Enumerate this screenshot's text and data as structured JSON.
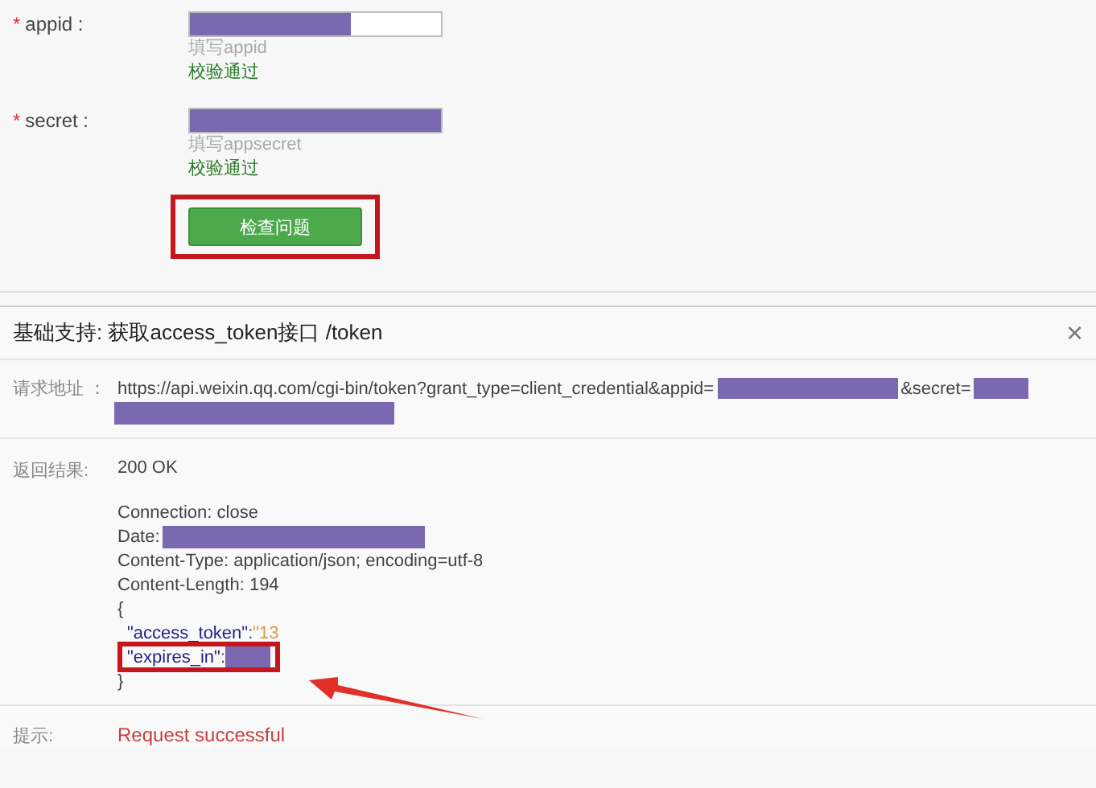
{
  "form": {
    "fields": [
      {
        "required_mark": "*",
        "label": "appid :",
        "level": 0.64,
        "hint": "填写appid",
        "status": "校验通过"
      },
      {
        "required_mark": "*",
        "label": "secret :",
        "level": 1,
        "hint": "填写appsecret",
        "status": "校验通过"
      }
    ],
    "check_button": {
      "label": "检查问题",
      "highlighted": true
    }
  },
  "panel": {
    "title": "基础支持: 获取access_token接口 /token",
    "close": "×",
    "request": {
      "label": "请求地址 ：",
      "url": "https://api.weixin.qq.com/cgi-bin/token?grant_type=client_credential&appid=",
      "secret_param": "&secret="
    },
    "response": {
      "label": "返回结果:",
      "status": "200 OK",
      "lines": [
        {
          "kind": "text",
          "text": "Connection: close"
        },
        {
          "kind": "redacted",
          "text": "Date:"
        },
        {
          "kind": "text",
          "text": "Content-Type: application/json; encoding=utf-8"
        },
        {
          "kind": "text",
          "text": "Content-Length: 194"
        },
        {
          "kind": "text",
          "text": "{"
        },
        {
          "kind": "json",
          "key": "\"access_token\"",
          "sep": ": ",
          "value": "\"13",
          "highlighted": false
        },
        {
          "kind": "json_redacted",
          "key": "\"expires_in\"",
          "sep": ": ",
          "highlighted": true
        },
        {
          "kind": "text",
          "text": "}"
        }
      ]
    },
    "tip": {
      "label": "提示:",
      "message": "Request successful"
    }
  }
}
